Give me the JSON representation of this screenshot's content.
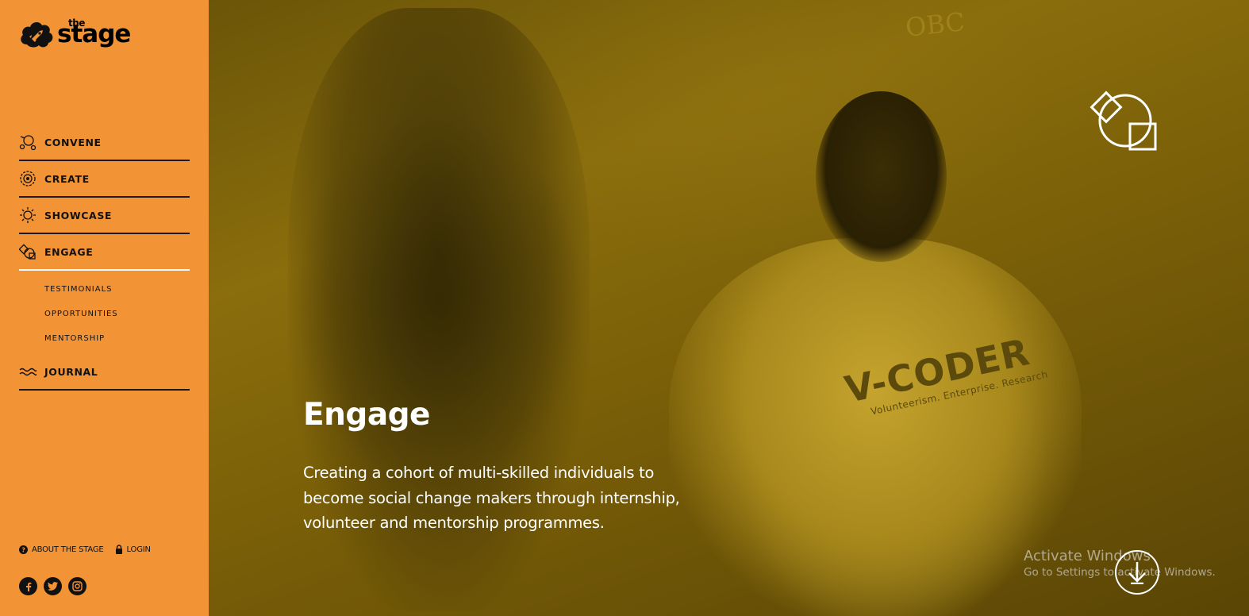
{
  "brand": {
    "logo_small": "the",
    "logo_large": "stage"
  },
  "nav": {
    "items": [
      {
        "label": "CONVENE",
        "icon": "convene-icon"
      },
      {
        "label": "CREATE",
        "icon": "create-icon"
      },
      {
        "label": "SHOWCASE",
        "icon": "showcase-icon"
      },
      {
        "label": "ENGAGE",
        "icon": "engage-icon",
        "active": true
      },
      {
        "label": "JOURNAL",
        "icon": "journal-icon"
      }
    ],
    "subitems": [
      "TESTIMONIALS",
      "OPPORTUNITIES",
      "MENTORSHIP"
    ]
  },
  "footer": {
    "about": "ABOUT THE STAGE",
    "login": "LOGIN",
    "socials": [
      "facebook-icon",
      "twitter-icon",
      "instagram-icon"
    ]
  },
  "hero": {
    "title": "Engage",
    "description": "Creating a cohort of multi-skilled individuals to become social change makers through internship, volunteer and mentorship programmes.",
    "shirt_text": "V-CODER",
    "shirt_subtext": "Volunteerism. Enterprise. Research",
    "wall_text": "OBC"
  },
  "overlay": {
    "activate_title": "Activate Windows",
    "activate_sub": "Go to Settings to activate Windows."
  },
  "colors": {
    "sidebar": "#f29335",
    "tint": "#8a6d0c",
    "text_dark": "#111111",
    "text_light": "#ffffff"
  }
}
